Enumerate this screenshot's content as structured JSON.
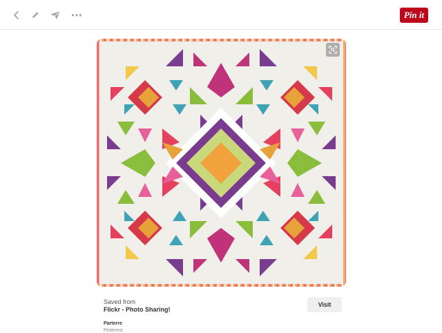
{
  "toolbar": {
    "icons": [
      "back-icon",
      "edit-icon",
      "send-icon",
      "more-icon"
    ],
    "pin_label": "Pin it",
    "pin_color": "#bd081c"
  },
  "pin": {
    "image": "quilt-photo",
    "saved_from_label": "Saved from",
    "source_name": "Flickr - Photo Sharing!",
    "visit_label": "Visit",
    "board_name": "Parterre",
    "board_subtitle": "Pinterest"
  }
}
